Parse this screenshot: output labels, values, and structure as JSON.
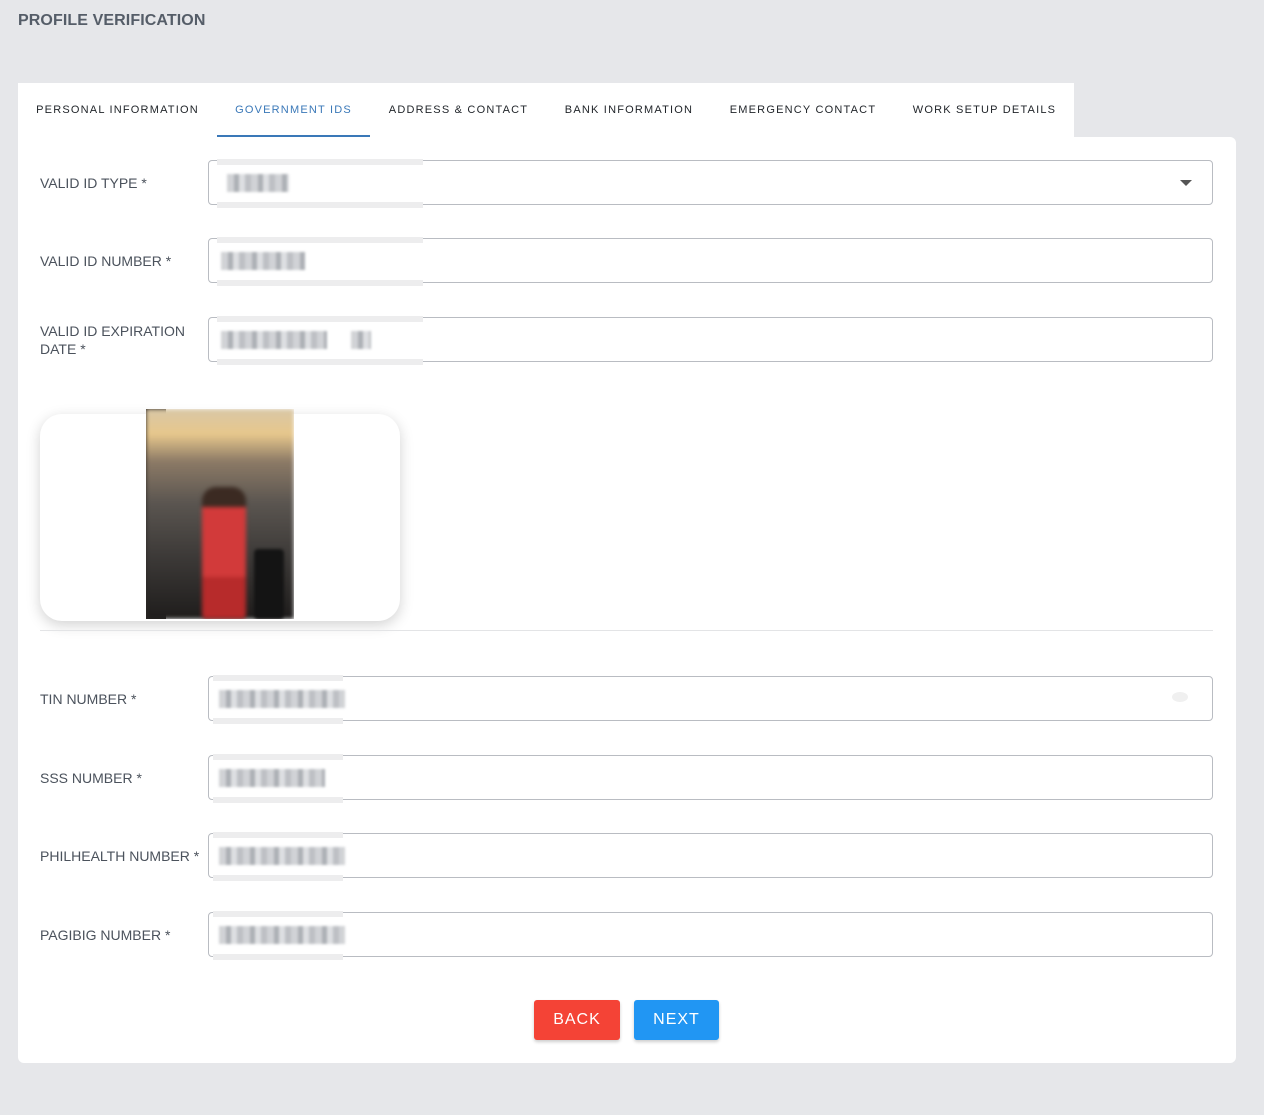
{
  "page": {
    "title": "PROFILE VERIFICATION"
  },
  "tabs": [
    {
      "label": "PERSONAL INFORMATION",
      "active": false
    },
    {
      "label": "GOVERNMENT IDS",
      "active": true
    },
    {
      "label": "ADDRESS & CONTACT",
      "active": false
    },
    {
      "label": "BANK INFORMATION",
      "active": false
    },
    {
      "label": "EMERGENCY CONTACT",
      "active": false
    },
    {
      "label": "WORK SETUP DETAILS",
      "active": false
    }
  ],
  "form": {
    "valid_id_type": {
      "label": "VALID ID TYPE *"
    },
    "valid_id_number": {
      "label": "VALID ID NUMBER *"
    },
    "valid_id_expiration": {
      "label": "VALID ID EXPIRATION DATE *"
    },
    "tin_number": {
      "label": "TIN NUMBER *"
    },
    "sss_number": {
      "label": "SSS NUMBER *"
    },
    "philhealth_number": {
      "label": "PHILHEALTH NUMBER *"
    },
    "pagibig_number": {
      "label": "PAGIBIG NUMBER *"
    }
  },
  "buttons": {
    "back": "BACK",
    "next": "NEXT"
  },
  "colors": {
    "accent": "#3a78b8",
    "back_button": "#f44336",
    "next_button": "#2196f3",
    "background": "#e6e7ea"
  },
  "icons": {
    "dropdown": "caret-down-icon",
    "visibility": "eye-icon"
  }
}
